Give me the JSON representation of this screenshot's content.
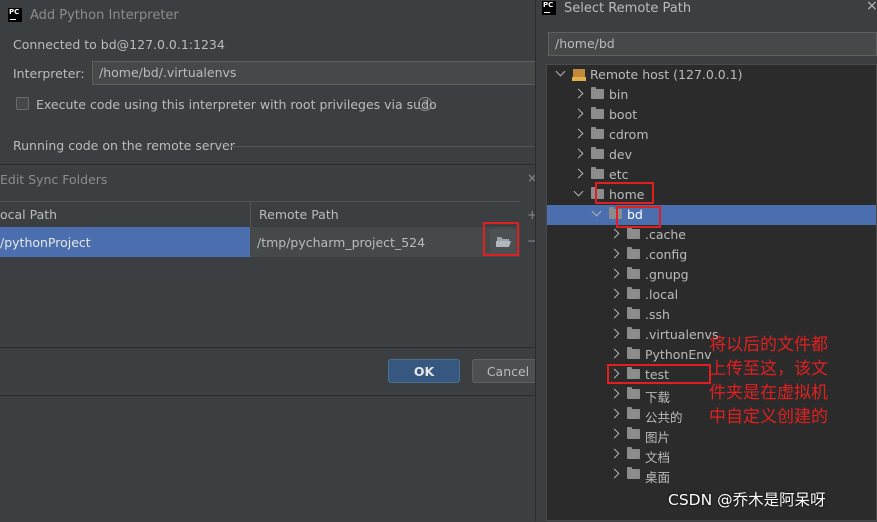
{
  "left_dialog": {
    "title": "Add Python Interpreter",
    "connected_text": "Connected to bd@127.0.0.1:1234",
    "interpreter_label": "Interpreter:",
    "interpreter_value": "/home/bd/.virtualenvs",
    "sudo_checkbox_label": "Execute code using this interpreter with root privileges via sudo",
    "sudo_checked": false,
    "running_section": "Running code on the remote server",
    "sync_title": "Edit Sync Folders",
    "table_headers": [
      "ocal Path",
      "Remote Path"
    ],
    "table_rows": [
      {
        "local": "/pythonProject",
        "remote": "/tmp/pycharm_project_524"
      }
    ],
    "ok_label": "OK",
    "cancel_label": "Cancel"
  },
  "right_dialog": {
    "title": "Select Remote Path",
    "path_value": "/home/bd",
    "tree_root": "Remote host (127.0.0.1)",
    "tree_items": [
      {
        "label": "bin",
        "level": 1,
        "expanded": false
      },
      {
        "label": "boot",
        "level": 1,
        "expanded": false
      },
      {
        "label": "cdrom",
        "level": 1,
        "expanded": false
      },
      {
        "label": "dev",
        "level": 1,
        "expanded": false
      },
      {
        "label": "etc",
        "level": 1,
        "expanded": false
      },
      {
        "label": "home",
        "level": 1,
        "expanded": true
      },
      {
        "label": "bd",
        "level": 2,
        "expanded": true,
        "selected": true
      },
      {
        "label": ".cache",
        "level": 3,
        "expanded": false
      },
      {
        "label": ".config",
        "level": 3,
        "expanded": false
      },
      {
        "label": ".gnupg",
        "level": 3,
        "expanded": false
      },
      {
        "label": ".local",
        "level": 3,
        "expanded": false
      },
      {
        "label": ".ssh",
        "level": 3,
        "expanded": false
      },
      {
        "label": ".virtualenvs",
        "level": 3,
        "expanded": false
      },
      {
        "label": "PythonEnv",
        "level": 3,
        "expanded": false
      },
      {
        "label": "test",
        "level": 3,
        "expanded": false
      },
      {
        "label": "下载",
        "level": 3,
        "expanded": false
      },
      {
        "label": "公共的",
        "level": 3,
        "expanded": false
      },
      {
        "label": "图片",
        "level": 3,
        "expanded": false
      },
      {
        "label": "文档",
        "level": 3,
        "expanded": false
      },
      {
        "label": "桌面",
        "level": 3,
        "expanded": false
      }
    ]
  },
  "annotation_lines": [
    "将以后的文件都",
    "上传至这，该文",
    "件夹是在虚拟机",
    "中自定义创建的"
  ],
  "watermark": "CSDN @乔木是阿呆呀",
  "colors": {
    "selection": "#4b6eaf",
    "annotation": "#e02020",
    "ok_button": "#365880"
  }
}
